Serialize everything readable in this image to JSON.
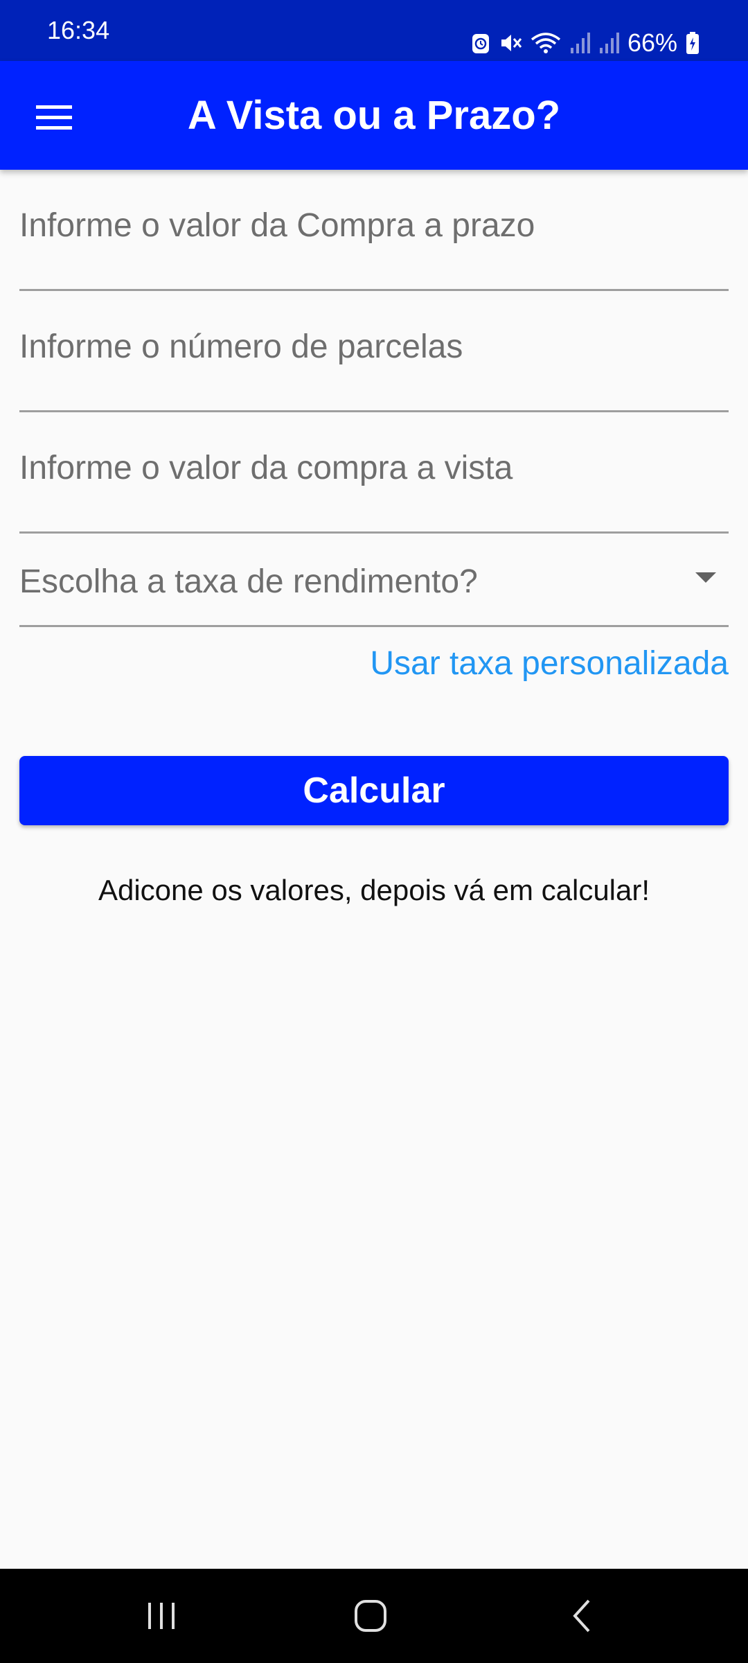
{
  "status_bar": {
    "time": "16:34",
    "battery": "66%",
    "icons": [
      "alarm-icon",
      "mute-icon",
      "wifi-icon",
      "signal-icon",
      "signal-icon",
      "battery-icon"
    ]
  },
  "app_bar": {
    "title": "A Vista ou a Prazo?",
    "menu_icon": "hamburger-menu-icon"
  },
  "form": {
    "purchase_installment_value": {
      "value": "",
      "placeholder": "Informe o valor da Compra a prazo"
    },
    "installments_count": {
      "value": "",
      "placeholder": "Informe o número de parcelas"
    },
    "cash_purchase_value": {
      "value": "",
      "placeholder": "Informe o valor da compra a vista"
    },
    "yield_rate": {
      "selected": "Escolha a taxa de rendimento?"
    },
    "custom_rate_link": "Usar taxa personalizada",
    "calculate_button": "Calcular",
    "hint": "Adicone os valores, depois vá em calcular!"
  },
  "nav_bar": {
    "buttons": [
      "recents-icon",
      "home-icon",
      "back-icon"
    ]
  },
  "colors": {
    "status_bar": "#0022B8",
    "app_bar": "#0022FF",
    "button": "#0022FF",
    "link": "#2196F3",
    "background": "#FAFAFA"
  }
}
